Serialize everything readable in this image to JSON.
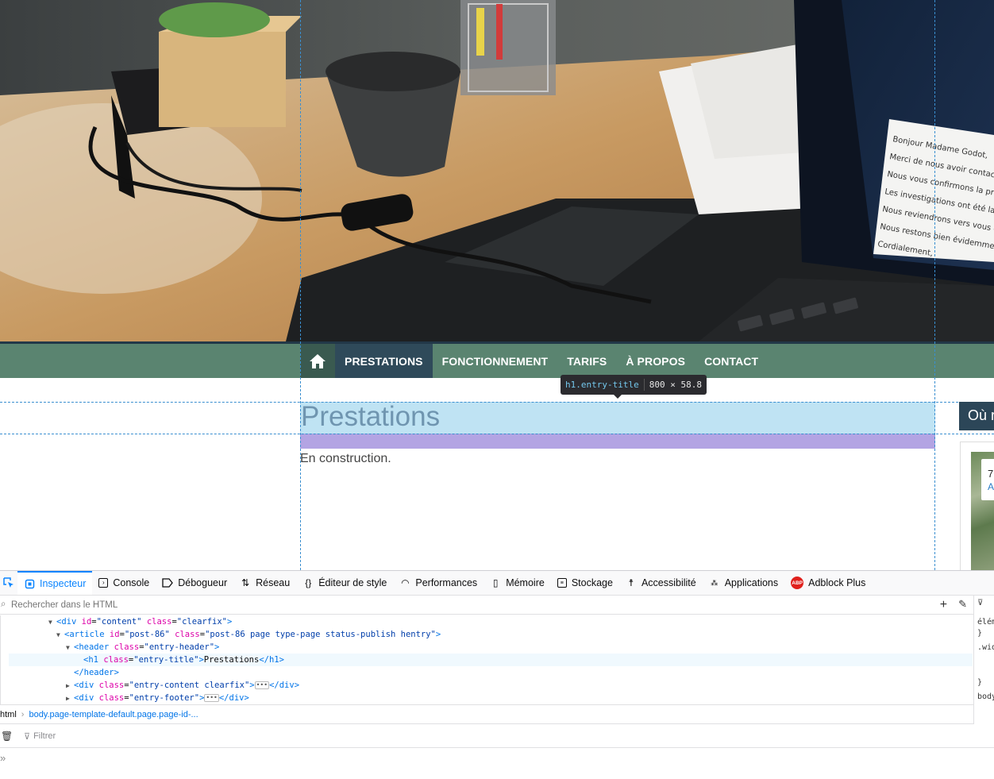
{
  "nav": {
    "items": [
      {
        "label": "PRESTATIONS",
        "active": true
      },
      {
        "label": "FONCTIONNEMENT"
      },
      {
        "label": "TARIFS"
      },
      {
        "label": "À PROPOS"
      },
      {
        "label": "CONTACT"
      }
    ],
    "bar_color": "#5a8470",
    "active_color": "#2f4a5a"
  },
  "page": {
    "title": "Prestations",
    "body": "En construction."
  },
  "highlighter": {
    "tag": "h1.entry-title",
    "dims": "800 × 58.8"
  },
  "sidebar": {
    "widget_title": "Où r",
    "map_popup": {
      "line1": "7",
      "line2": "A"
    }
  },
  "hero_screen_lines": [
    "Bonjour Madame Godot,",
    "Merci de nous avoir contacté",
    "Nous vous confirmons la prise",
    "Les investigations ont été lancé",
    "Nous reviendrons vers vous dè",
    "Nous restons bien évidemment",
    "Cordialement,"
  ],
  "devtools": {
    "tabs": [
      {
        "label": "Inspecteur",
        "icon": "inspector-icon",
        "active": true
      },
      {
        "label": "Console",
        "icon": "console-icon"
      },
      {
        "label": "Débogueur",
        "icon": "debugger-icon"
      },
      {
        "label": "Réseau",
        "icon": "network-icon"
      },
      {
        "label": "Éditeur de style",
        "icon": "style-editor-icon"
      },
      {
        "label": "Performances",
        "icon": "performance-icon"
      },
      {
        "label": "Mémoire",
        "icon": "memory-icon"
      },
      {
        "label": "Stockage",
        "icon": "storage-icon"
      },
      {
        "label": "Accessibilité",
        "icon": "accessibility-icon"
      },
      {
        "label": "Applications",
        "icon": "applications-icon"
      },
      {
        "label": "Adblock Plus",
        "icon": "adblock-plus-icon"
      }
    ],
    "search_placeholder": "Rechercher dans le HTML",
    "tree": {
      "r0_tag": "div",
      "r0_a1": "id",
      "r0_v1": "\"content\"",
      "r0_a2": "class",
      "r0_v2": "\"clearfix\"",
      "r1_tag": "article",
      "r1_a1": "id",
      "r1_v1": "\"post-86\"",
      "r1_a2": "class",
      "r1_v2": "\"post-86 page type-page status-publish hentry\"",
      "r2_tag": "header",
      "r2_a1": "class",
      "r2_v1": "\"entry-header\"",
      "r3_tag": "h1",
      "r3_a1": "class",
      "r3_v1": "\"entry-title\"",
      "r3_text": "Prestations",
      "r4_tag": "header",
      "r5_tag": "div",
      "r5_a1": "class",
      "r5_v1": "\"entry-content clearfix\"",
      "r6_tag": "div",
      "r6_a1": "class",
      "r6_v1": "\"entry-footer\""
    },
    "breadcrumb": [
      "html",
      "body.page-template-default.page.page-id-..."
    ],
    "side_rules": [
      "élém",
      "}",
      ".wid",
      "}",
      "body"
    ],
    "console_filter": "Filtrer",
    "prompt": "»"
  }
}
